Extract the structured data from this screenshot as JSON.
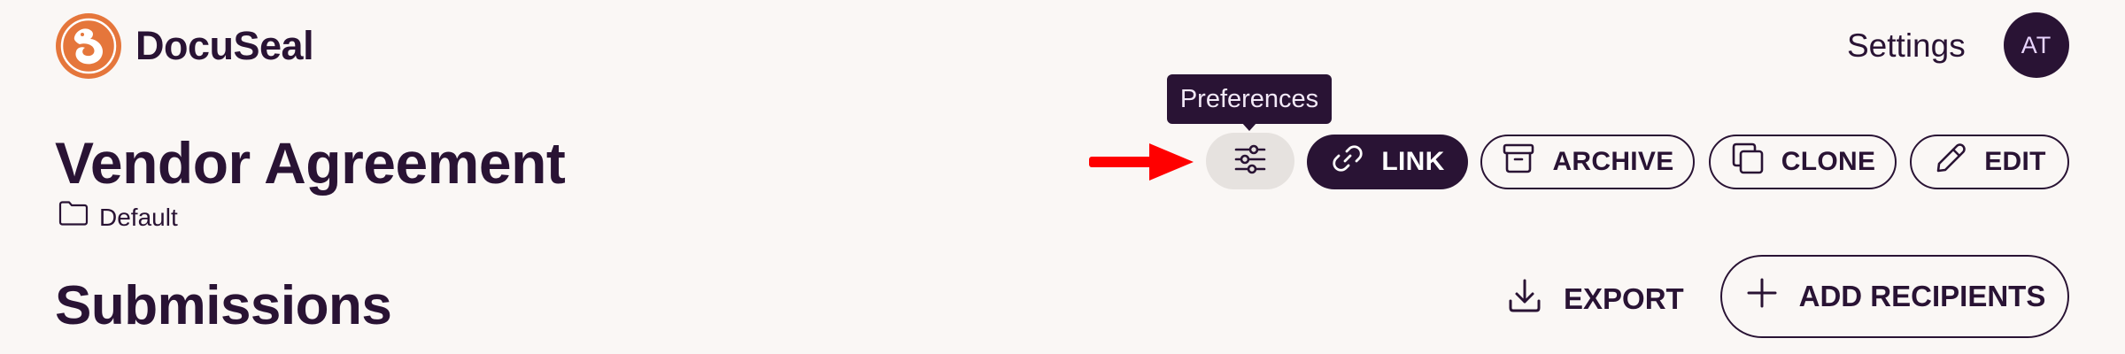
{
  "header": {
    "brand": "DocuSeal",
    "settings_label": "Settings",
    "avatar_initials": "AT",
    "logo_icon": "docuseal-logo-icon",
    "logo_color": "#e5763b"
  },
  "template": {
    "title": "Vendor Agreement",
    "folder": "Default",
    "folder_icon": "folder-icon"
  },
  "toolbar": {
    "preferences_tooltip": "Preferences",
    "preferences_icon": "sliders-icon",
    "link_label": "LINK",
    "link_icon": "link-icon",
    "archive_label": "ARCHIVE",
    "archive_icon": "archive-box-icon",
    "clone_label": "CLONE",
    "clone_icon": "copy-icon",
    "edit_label": "EDIT",
    "edit_icon": "pencil-icon"
  },
  "submissions": {
    "title": "Submissions",
    "export_label": "EXPORT",
    "export_icon": "download-icon",
    "add_recipients_label": "ADD RECIPIENTS",
    "add_icon": "plus-icon"
  },
  "colors": {
    "background": "#faf7f5",
    "primary": "#291334",
    "annotation_arrow": "#ff0000",
    "pref_button_bg": "#e6e2df"
  }
}
